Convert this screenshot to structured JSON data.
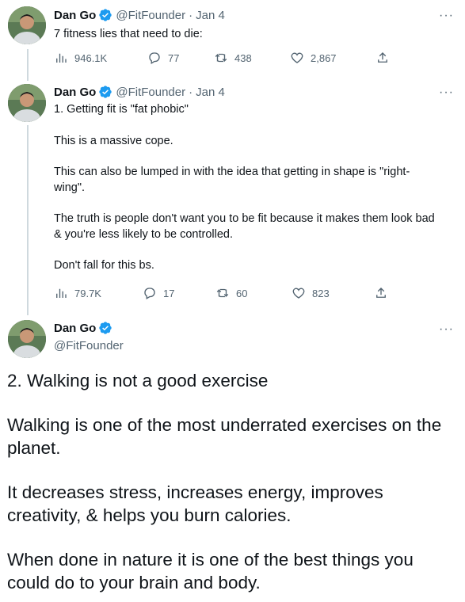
{
  "author": {
    "name": "Dan Go",
    "handle": "@FitFounder",
    "date": "Jan 4",
    "separator": "·"
  },
  "more_label": "···",
  "tweet1": {
    "text": "7 fitness lies that need to die:",
    "views": "946.1K",
    "replies": "77",
    "retweets": "438",
    "likes": "2,867"
  },
  "tweet2": {
    "paragraphs": [
      "1. Getting fit is \"fat phobic\"",
      "This is a massive cope.",
      "This can also be lumped in with the idea that getting in shape is \"right-wing\".",
      "The truth is people don't want you to be fit because it makes them look bad & you're less likely to be controlled.",
      "Don't fall for this bs."
    ],
    "views": "79.7K",
    "replies": "17",
    "retweets": "60",
    "likes": "823"
  },
  "tweet3": {
    "paragraphs": [
      "2. Walking is not a good exercise",
      "Walking is one of the most underrated exercises on the planet.",
      "It decreases stress, increases energy, improves creativity, & helps you burn calories.",
      "When done in nature it is one of the best things you could do to your brain and body."
    ]
  },
  "colors": {
    "verified": "#1d9bf0",
    "secondary_text": "#536471",
    "thread_line": "#cfd9de"
  },
  "icons": [
    "views-icon",
    "reply-icon",
    "retweet-icon",
    "like-icon",
    "share-icon",
    "verified-badge-icon",
    "more-icon"
  ]
}
